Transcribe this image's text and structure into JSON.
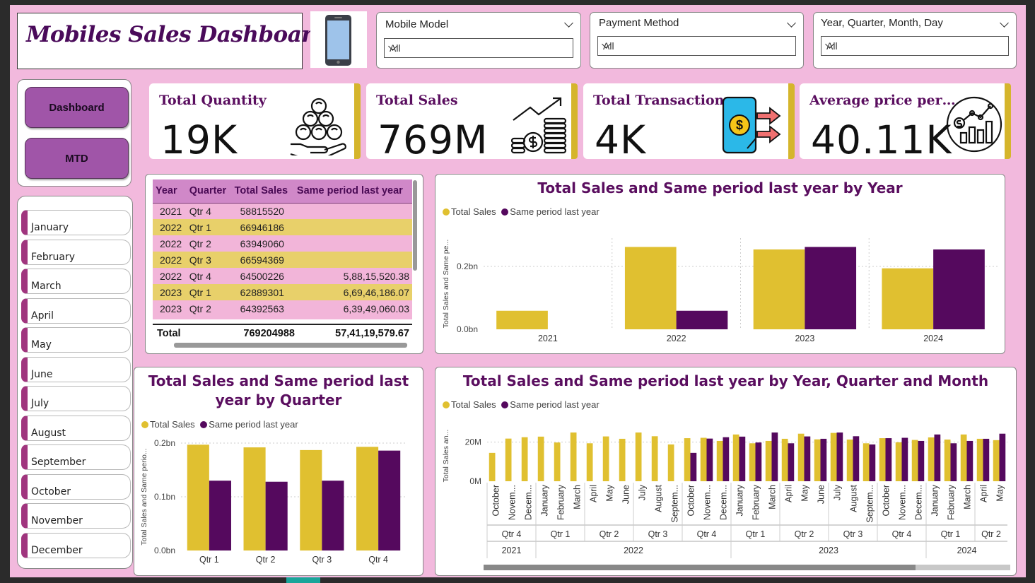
{
  "header": {
    "title": "Mobiles Sales Dashboard"
  },
  "slicers": [
    {
      "label": "Mobile Model",
      "value": "All"
    },
    {
      "label": "Payment Method",
      "value": "All"
    },
    {
      "label": "Year, Quarter, Month, Day",
      "value": "All"
    }
  ],
  "nav": {
    "dashboard": "Dashboard",
    "mtd": "MTD"
  },
  "months": [
    "January",
    "February",
    "March",
    "April",
    "May",
    "June",
    "July",
    "August",
    "September",
    "October",
    "November",
    "December"
  ],
  "kpis": [
    {
      "title": "Total Quantity",
      "value": "19K",
      "icon": "coins-in-hand-icon"
    },
    {
      "title": "Total Sales",
      "value": "769M",
      "icon": "coin-stack-growth-icon"
    },
    {
      "title": "Total Transactions",
      "value": "4K",
      "icon": "mobile-payment-icon"
    },
    {
      "title": "Average price per…",
      "value": "40.11K",
      "icon": "growth-chart-circle-icon"
    }
  ],
  "table": {
    "headers": [
      "Year",
      "Quarter",
      "Total Sales",
      "Same period last year"
    ],
    "rows": [
      [
        "2021",
        "Qtr 4",
        "58815520",
        ""
      ],
      [
        "2022",
        "Qtr 1",
        "66946186",
        ""
      ],
      [
        "2022",
        "Qtr 2",
        "63949060",
        ""
      ],
      [
        "2022",
        "Qtr 3",
        "66594369",
        ""
      ],
      [
        "2022",
        "Qtr 4",
        "64500226",
        "5,88,15,520.38"
      ],
      [
        "2023",
        "Qtr 1",
        "62889301",
        "6,69,46,186.07"
      ],
      [
        "2023",
        "Qtr 2",
        "64392563",
        "6,39,49,060.03"
      ]
    ],
    "total": {
      "label": "Total",
      "total_sales": "769204988",
      "same_period": "57,41,19,579.67"
    }
  },
  "colors": {
    "total_sales": "#e0c030",
    "same_period": "#55095e",
    "title": "#5a0e5f"
  },
  "chart_data": [
    {
      "type": "bar",
      "title": "Total Sales and Same period last year by Year",
      "categories": [
        "2021",
        "2022",
        "2023",
        "2024"
      ],
      "series": [
        {
          "name": "Total Sales",
          "values": [
            0.059,
            0.262,
            0.254,
            0.194
          ]
        },
        {
          "name": "Same period last year",
          "values": [
            0,
            0.059,
            0.262,
            0.254
          ]
        }
      ],
      "ylabel": "Total Sales and Same pe...",
      "yticks": [
        "0.0bn",
        "0.2bn"
      ],
      "ylim": [
        0,
        0.29
      ]
    },
    {
      "type": "bar",
      "title": "Total Sales and Same period last year by Quarter",
      "categories": [
        "Qtr 1",
        "Qtr 2",
        "Qtr 3",
        "Qtr 4"
      ],
      "series": [
        {
          "name": "Total Sales",
          "values": [
            0.197,
            0.192,
            0.187,
            0.193
          ]
        },
        {
          "name": "Same period last year",
          "values": [
            0.13,
            0.128,
            0.13,
            0.186
          ]
        }
      ],
      "ylabel": "Total Sales and Same perio...",
      "yticks": [
        "0.0bn",
        "0.1bn",
        "0.2bn"
      ],
      "ylim": [
        0,
        0.2
      ]
    },
    {
      "type": "bar",
      "title": "Total Sales and Same period last year by Year, Quarter and Month",
      "categories": [
        "October",
        "Novem...",
        "Decem...",
        "January",
        "February",
        "March",
        "April",
        "May",
        "June",
        "July",
        "August",
        "Septem...",
        "October",
        "Novem...",
        "Decem...",
        "January",
        "February",
        "March",
        "April",
        "May",
        "June",
        "July",
        "August",
        "Septem...",
        "October",
        "Novem...",
        "Decem...",
        "January",
        "February",
        "March",
        "April",
        "May"
      ],
      "quarters": [
        {
          "label": "Qtr 4",
          "span": 3
        },
        {
          "label": "Qtr 1",
          "span": 3
        },
        {
          "label": "Qtr 2",
          "span": 3
        },
        {
          "label": "Qtr 3",
          "span": 3
        },
        {
          "label": "Qtr 4",
          "span": 3
        },
        {
          "label": "Qtr 1",
          "span": 3
        },
        {
          "label": "Qtr 2",
          "span": 3
        },
        {
          "label": "Qtr 3",
          "span": 3
        },
        {
          "label": "Qtr 4",
          "span": 3
        },
        {
          "label": "Qtr 1",
          "span": 3
        },
        {
          "label": "Qtr 2",
          "span": 2
        }
      ],
      "years": [
        {
          "label": "2021",
          "span": 3
        },
        {
          "label": "2022",
          "span": 12
        },
        {
          "label": "2023",
          "span": 12
        },
        {
          "label": "2024",
          "span": 5
        }
      ],
      "series": [
        {
          "name": "Total Sales",
          "values": [
            14.5,
            21.8,
            22.5,
            22.8,
            19.8,
            24.9,
            19.4,
            22.9,
            21.7,
            24.9,
            23,
            18.8,
            22,
            22.2,
            20.6,
            23.9,
            19.4,
            20.6,
            21.7,
            24.3,
            21.4,
            24.7,
            21.3,
            19.4,
            22,
            19.9,
            21.1,
            22.4,
            21.3,
            23.9,
            21.7,
            21
          ]
        },
        {
          "name": "Same period last year",
          "values": [
            0,
            0,
            0,
            0,
            0,
            0,
            0,
            0,
            0,
            0,
            0,
            0,
            14.5,
            21.8,
            22.5,
            22.8,
            19.8,
            24.9,
            19.4,
            22.9,
            21.7,
            24.9,
            23,
            18.8,
            22,
            22.2,
            20.6,
            23.9,
            19.4,
            20.6,
            21.7,
            24.3
          ]
        }
      ],
      "ylabel": "Total Sales an...",
      "yticks": [
        "0M",
        "20M"
      ],
      "ylim": [
        0,
        26
      ]
    }
  ]
}
